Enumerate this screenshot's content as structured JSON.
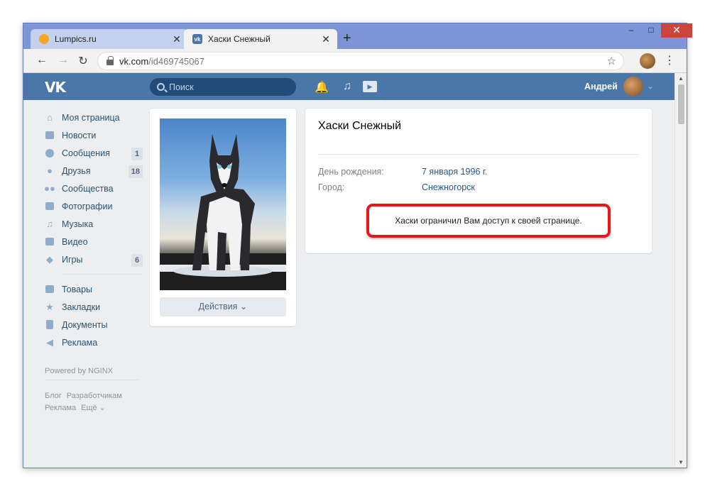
{
  "browser": {
    "tabs": [
      {
        "label": "Lumpics.ru",
        "close": "✕"
      },
      {
        "label": "Хаски Снежный",
        "close": "✕"
      }
    ],
    "new_tab": "+",
    "window_controls": {
      "minimize": "‒",
      "maximize": "□",
      "close": "✕"
    },
    "nav": {
      "back": "←",
      "forward": "→",
      "reload": "↻"
    },
    "url_host": "vk.com",
    "url_path": "/id469745067",
    "star": "☆",
    "menu": "⋮"
  },
  "vk": {
    "logo": "VK",
    "search_placeholder": "Поиск",
    "icons": {
      "bell": "🔔",
      "music": "♫",
      "video": "▶"
    },
    "user_name": "Андрей",
    "user_chevron": "⌄",
    "menu": [
      {
        "label": "Моя страница",
        "icon": "home-icon"
      },
      {
        "label": "Новости",
        "icon": "news-icon"
      },
      {
        "label": "Сообщения",
        "icon": "messages-icon",
        "badge": "1"
      },
      {
        "label": "Друзья",
        "icon": "friends-icon",
        "badge": "18"
      },
      {
        "label": "Сообщества",
        "icon": "groups-icon"
      },
      {
        "label": "Фотографии",
        "icon": "photo-icon"
      },
      {
        "label": "Музыка",
        "icon": "music-icon"
      },
      {
        "label": "Видео",
        "icon": "video-icon"
      },
      {
        "label": "Игры",
        "icon": "games-icon",
        "badge": "6"
      }
    ],
    "menu2": [
      {
        "label": "Товары",
        "icon": "bag-icon"
      },
      {
        "label": "Закладки",
        "icon": "star-icon"
      },
      {
        "label": "Документы",
        "icon": "document-icon"
      },
      {
        "label": "Реклама",
        "icon": "megaphone-icon"
      }
    ],
    "powered": "Powered by NGINX",
    "footer": {
      "blog": "Блог",
      "devs": "Разработчикам",
      "ads": "Реклама",
      "more": "Ещё ⌄"
    },
    "actions_button": "Действия ⌄",
    "profile": {
      "name": "Хаски Снежный",
      "birthday_label": "День рождения:",
      "birthday_value": "7 января 1996 г.",
      "city_label": "Город:",
      "city_value": "Снежногорск",
      "notice": "Хаски ограничил Вам доступ к своей странице."
    }
  },
  "colors": {
    "vk_blue": "#4a76a8",
    "highlight_red": "#e8151b",
    "window_frame": "#7b95d6"
  }
}
